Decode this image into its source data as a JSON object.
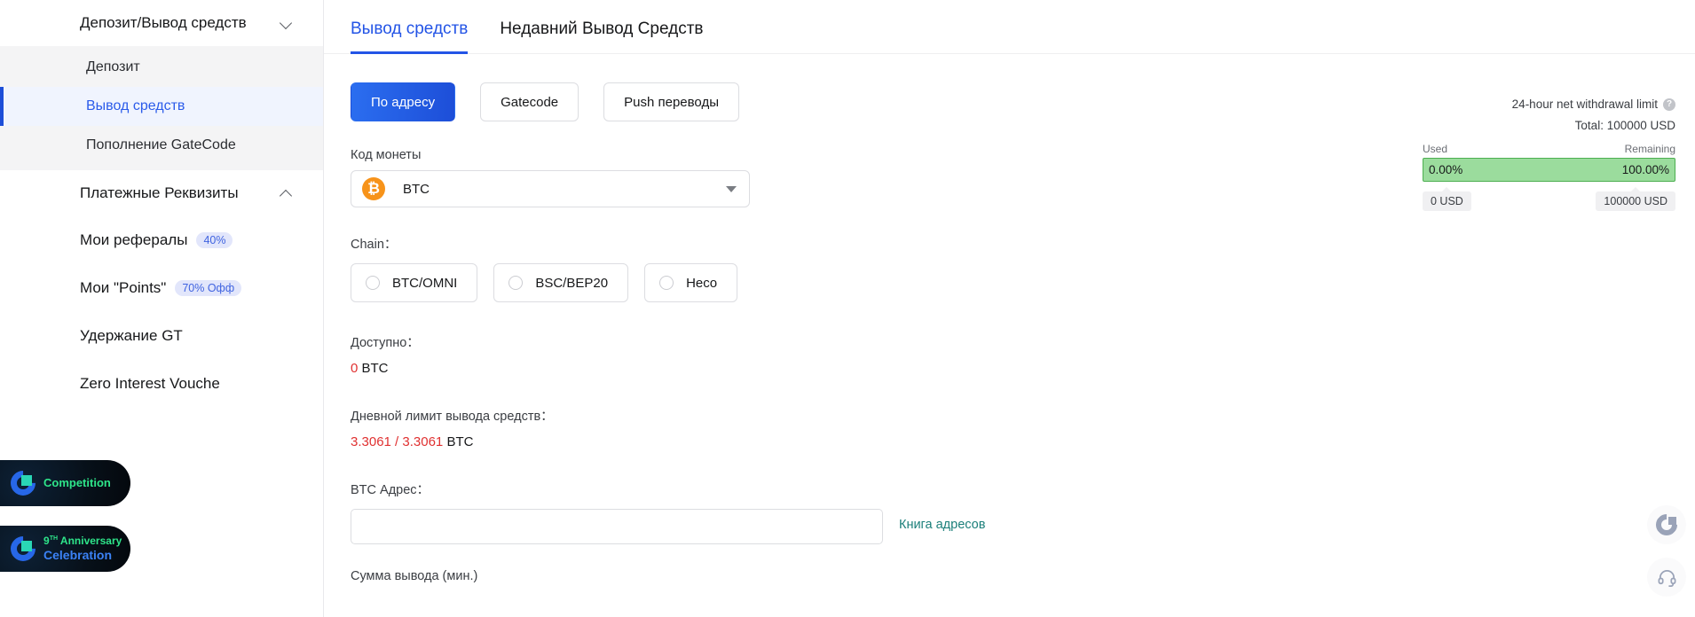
{
  "sidebar": {
    "groups": [
      {
        "label": "Депозит/Вывод средств",
        "chevron": "chevron-down-icon",
        "items": [
          {
            "label": "Депозит",
            "active": false
          },
          {
            "label": "Вывод средств",
            "active": true
          },
          {
            "label": "Пополнение GateCode",
            "active": false
          }
        ]
      },
      {
        "label": "Платежные Реквизиты",
        "chevron": "chevron-up-icon",
        "items": []
      }
    ],
    "links": [
      {
        "label": "Мои рефералы",
        "badge": "40%"
      },
      {
        "label": "Мои \"Points\"",
        "badge": "70% Офф"
      },
      {
        "label": "Удержание GT",
        "badge": ""
      },
      {
        "label": "Zero Interest Vouche",
        "badge": ""
      }
    ],
    "banners": [
      {
        "line1": "Competition",
        "line2": "",
        "sup": ""
      },
      {
        "line1": "Anniversary",
        "line2": "Celebration",
        "sup": "TH",
        "num": "9"
      }
    ]
  },
  "main": {
    "tabs": [
      {
        "label": "Вывод средств",
        "active": true
      },
      {
        "label": "Недавний Вывод Средств",
        "active": false
      }
    ],
    "methods": [
      {
        "label": "По адресу",
        "primary": true
      },
      {
        "label": "Gatecode",
        "primary": false
      },
      {
        "label": "Push переводы",
        "primary": false
      }
    ],
    "coin": {
      "label": "Код монеты",
      "icon": "bitcoin-icon",
      "symbol": "₿",
      "value": "BTC"
    },
    "chain": {
      "label": "Chain：",
      "options": [
        {
          "label": "BTC/OMNI",
          "selected": false
        },
        {
          "label": "BSC/BEP20",
          "selected": false
        },
        {
          "label": "Heco",
          "selected": false
        }
      ]
    },
    "available": {
      "label": "Доступно：",
      "amount": "0",
      "unit": "BTC"
    },
    "daily_limit": {
      "label": "Дневной лимит вывода средств：",
      "amount": "3.3061 / 3.3061",
      "unit": "BTC"
    },
    "address": {
      "label": "BTC Адрес：",
      "value": "",
      "placeholder": "",
      "book_link": "Книга адресов"
    },
    "cut_off_label": "Сумма вывода (мин.)"
  },
  "limit_panel": {
    "title": "24-hour net withdrawal limit",
    "help_icon": "help-icon",
    "total": "Total: 100000 USD",
    "used_header": "Used",
    "remaining_header": "Remaining",
    "used_percent": "0.00%",
    "remaining_percent": "100.00%",
    "used_amount": "0 USD",
    "remaining_amount": "100000 USD",
    "bar_fill_color": "#9bdc9d",
    "bar_border_color": "#4caf50"
  },
  "floats": [
    {
      "name": "gate-logo-button"
    },
    {
      "name": "support-headset-button"
    }
  ],
  "colors": {
    "accent": "#2354e6",
    "primary_button": "#1d4ed8",
    "danger": "#e03131",
    "link_teal": "#1b7f7a",
    "bitcoin_orange": "#f7931a"
  }
}
